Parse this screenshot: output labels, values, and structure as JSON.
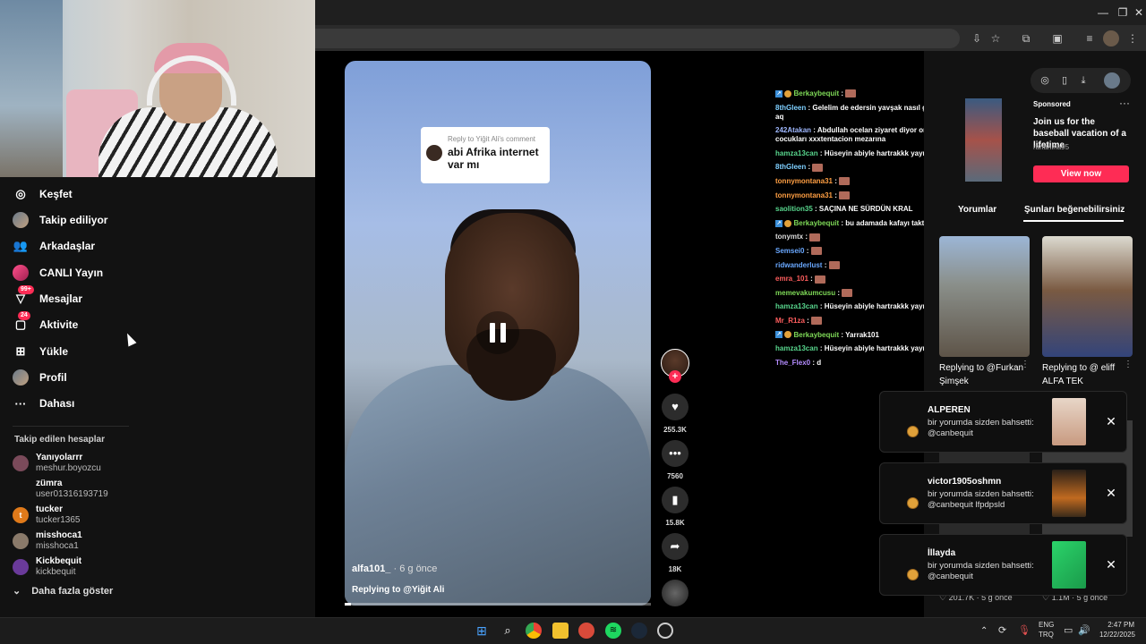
{
  "browser": {
    "window_controls": [
      "—",
      "❐",
      "✕"
    ],
    "toolbar_icons": [
      "install-icon",
      "star-icon",
      "extensions-icon",
      "media-icon",
      "reading-list-icon",
      "profile-icon",
      "menu-icon"
    ]
  },
  "sidebar": {
    "nav": [
      {
        "label": "Keşfet",
        "icon": "compass-icon"
      },
      {
        "label": "Takip ediliyor",
        "icon": "avatar"
      },
      {
        "label": "Arkadaşlar",
        "icon": "friends-icon"
      },
      {
        "label": "CANLI Yayın",
        "icon": "live-icon"
      },
      {
        "label": "Mesajlar",
        "icon": "message-icon",
        "badge": "99+"
      },
      {
        "label": "Aktivite",
        "icon": "activity-icon",
        "badge": "24"
      },
      {
        "label": "Yükle",
        "icon": "upload-icon"
      },
      {
        "label": "Profil",
        "icon": "profile-avatar"
      },
      {
        "label": "Dahası",
        "icon": "more-icon"
      }
    ],
    "following_title": "Takip edilen hesaplar",
    "accounts": [
      {
        "name": "Yanıyolarrr",
        "user": "meshur.boyozcu"
      },
      {
        "name": "zümra",
        "user": "user01316193719"
      },
      {
        "name": "tucker",
        "user": "tucker1365",
        "initial": "t"
      },
      {
        "name": "misshoca1",
        "user": "misshoca1"
      },
      {
        "name": "Kickbequit",
        "user": "kickbequit"
      }
    ],
    "show_more": "Daha fazla göster"
  },
  "video": {
    "reply_label": "Reply to Yiğit Ali's comment",
    "reply_text": "abi Afrika internet var mı",
    "author": "alfa101_",
    "ago": "· 6 g önce",
    "replying_to": "Replying to @Yiğit Ali",
    "likes": "255.3K",
    "comments": "7560",
    "saves": "15.8K",
    "shares": "18K",
    "progress": 0.02
  },
  "chat": [
    {
      "badges": true,
      "user": "Berkaybequit",
      "color": "#7ed957",
      "text": ":",
      "emote": true
    },
    {
      "user": "8thGleen",
      "color": "#7ecfff",
      "text": ": Gelelim de edersin yavşak nasıl gelelim aq"
    },
    {
      "user": "242Atakan",
      "color": "#9fb8ff",
      "text": ": Abdullah ocelan ziyaret diyor orospu cocukları xxxtentacion mezarına"
    },
    {
      "user": "hamza13can",
      "color": "#58d68d",
      "text": ": Hüseyin abiyle hartrakkk yaynı"
    },
    {
      "user": "8thGleen",
      "color": "#7ecfff",
      "text": ":",
      "emote": true
    },
    {
      "user": "tonnymontana31",
      "color": "#ff9f43",
      "text": ":",
      "emote": true
    },
    {
      "user": "tonnymontana31",
      "color": "#ff9f43",
      "text": ":",
      "emote": true
    },
    {
      "user": "saolition35",
      "color": "#58d68d",
      "text": ": SAÇINA NE SÜRDÜN KRAL"
    },
    {
      "badges": true,
      "user": "Berkaybequit",
      "color": "#7ed957",
      "text": ": bu adamada kafayı taktılar"
    },
    {
      "user": "tonymtx",
      "color": "#dcdcdc",
      "text": ":",
      "emote": true
    },
    {
      "user": "Semsei0",
      "color": "#6aa8ff",
      "text": ":",
      "emote": true
    },
    {
      "user": "ridwanderlust",
      "color": "#6aa8ff",
      "text": ":",
      "emote": true
    },
    {
      "user": "emra_101",
      "color": "#ff5e5e",
      "text": ":",
      "emote": true
    },
    {
      "user": "memevakumcusu",
      "color": "#7ed957",
      "text": ":",
      "emote": true
    },
    {
      "user": "hamza13can",
      "color": "#58d68d",
      "text": ": Hüseyin abiyle hartrakkk yaynı"
    },
    {
      "user": "Mr_R1za",
      "color": "#ff5e5e",
      "text": ":",
      "emote": true
    },
    {
      "badges": true,
      "user": "Berkaybequit",
      "color": "#7ed957",
      "text": ": Yarrak101"
    },
    {
      "user": "hamza13can",
      "color": "#58d68d",
      "text": ": Hüseyin abiyle hartrakkk yaynı"
    },
    {
      "user": "The_Flex0",
      "color": "#b48cff",
      "text": ": d"
    }
  ],
  "right_panel": {
    "sponsored_label": "Sponsored",
    "sponsored_title": "Join us for the baseball vacation of a lifetime",
    "sponsored_sub": "ranahina95",
    "view_now": "View now",
    "tabs": [
      "Yorumlar",
      "Şunları beğenebilirsiniz"
    ],
    "thumbs": [
      {
        "caption": "Replying to @Furkan Şimşek"
      },
      {
        "caption": "Replying to @ eliff ALFA TEK"
      }
    ],
    "stats": [
      "♡ 201.7K · 5 g önce",
      "♡ 1.1M · 5 g önce"
    ]
  },
  "notifications": [
    {
      "user": "ALPEREN",
      "message": "bir yorumda sizden bahsetti: @canbequit"
    },
    {
      "user": "victor1905oshmn",
      "message": "bir yorumda sizden bahsetti: @canbequit lfpdpsld"
    },
    {
      "user": "İllayda",
      "message": "bir yorumda sizden bahsetti: @canbequit"
    }
  ],
  "taskbar": {
    "lang": "ENG",
    "lang2": "TRQ",
    "time": "2:47 PM",
    "date": "12/22/2025"
  }
}
